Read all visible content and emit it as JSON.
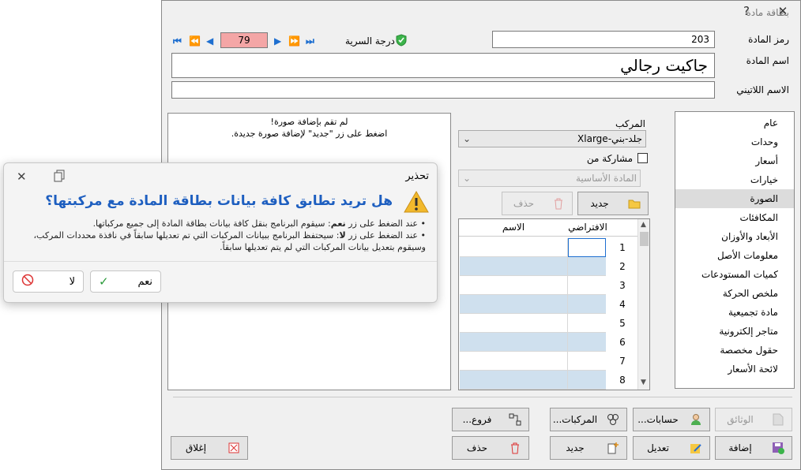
{
  "window": {
    "title": "بطاقة مادة",
    "help": "?",
    "close": "✕"
  },
  "fields": {
    "code_label": "رمز المادة",
    "code_value": "203",
    "name_label": "اسم المادة",
    "name_value": "جاكيت رجالي",
    "latin_label": "الاسم اللاتيني",
    "latin_value": "",
    "record_number": "79",
    "secrecy_label": "درجة السرية"
  },
  "sidebar": {
    "items": [
      "عام",
      "وحدات",
      "أسعار",
      "خيارات",
      "الصورة",
      "المكافئات",
      "الأبعاد والأوزان",
      "معلومات الأصل",
      "كميات المستودعات",
      "ملخص الحركة",
      "مادة تجميعية",
      "متاجر إلكترونية",
      "حقول مخصصة",
      "لائحة الأسعار"
    ],
    "selected_index": 4
  },
  "image_panel": {
    "line1": "لم تقم بإضافة صورة!",
    "line2": "اضغط على زر \"جديد\" لإضافة صورة جديدة."
  },
  "composite": {
    "label": "المركب",
    "value": "جلد-بني-Xlarge",
    "share_label": "مشاركة من",
    "base_placeholder": "المادة الأساسية",
    "new_label": "جديد",
    "delete_label": "حذف",
    "col_default": "الافتراضي",
    "col_name": "الاسم",
    "rows": [
      "1",
      "2",
      "3",
      "4",
      "5",
      "6",
      "7",
      "8"
    ]
  },
  "buttons": {
    "documents": "الوثائق",
    "accounts": "حسابات...",
    "composites": "المركبات...",
    "branches": "فروع...",
    "add": "إضافة",
    "edit": "تعديل",
    "new": "جديد",
    "delete": "حذف",
    "close": "إغلاق"
  },
  "dialog": {
    "title": "تحذير",
    "question": "هل تريد تطابق كافة بيانات بطاقة المادة مع مركبتها؟",
    "line1_pre": "عند الضغط على زر ",
    "line1_key": "نعم",
    "line1_post": ": سيقوم البرنامج بنقل كافة بيانات بطاقة المادة إلى جميع مركباتها.",
    "line2_pre": "عند الضغط على زر ",
    "line2_key": "لا",
    "line2_post": ": سيحتفظ البرنامج ببيانات المركبات التي تم تعديلها سابقاً في نافذة محددات المركب، وسيقوم بتعديل بيانات المركبات التي لم يتم تعديلها سابقاً.",
    "yes": "نعم",
    "no": "لا"
  },
  "colors": {
    "accent": "#1e6fd0",
    "record_bg": "#f4a6a6",
    "grid_row_alt": "#cfe0ee",
    "warning": "#f2b92c"
  }
}
